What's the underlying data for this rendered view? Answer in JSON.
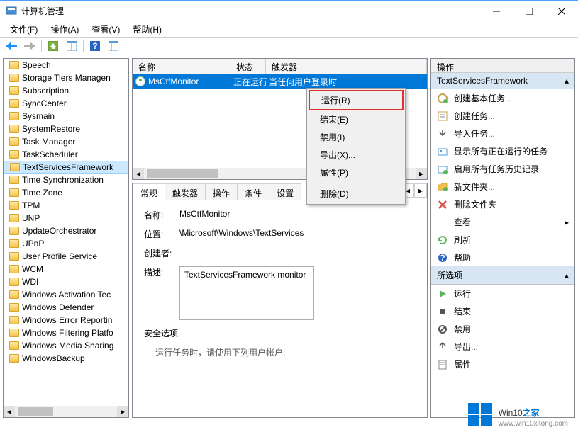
{
  "window": {
    "title": "计算机管理",
    "minimize": "—",
    "maximize": "☐",
    "close": "✕"
  },
  "menubar": [
    "文件(F)",
    "操作(A)",
    "查看(V)",
    "帮助(H)"
  ],
  "tree": {
    "items": [
      "Speech",
      "Storage Tiers Managen",
      "Subscription",
      "SyncCenter",
      "Sysmain",
      "SystemRestore",
      "Task Manager",
      "TaskScheduler",
      "TextServicesFramework",
      "Time Synchronization",
      "Time Zone",
      "TPM",
      "UNP",
      "UpdateOrchestrator",
      "UPnP",
      "User Profile Service",
      "WCM",
      "WDI",
      "Windows Activation Tec",
      "Windows Defender",
      "Windows Error Reportin",
      "Windows Filtering Platfo",
      "Windows Media Sharing",
      "WindowsBackup"
    ],
    "selectedIndex": 8
  },
  "taskList": {
    "columns": {
      "name": "名称",
      "state": "状态",
      "trigger": "触发器"
    },
    "row": {
      "name": "MsCtfMonitor",
      "state": "正在运行",
      "trigger": "当任何用户登录时"
    }
  },
  "contextMenu": {
    "items": [
      "运行(R)",
      "结束(E)",
      "禁用(I)",
      "导出(X)...",
      "属性(P)",
      "删除(D)"
    ],
    "highlightIndex": 0
  },
  "detail": {
    "tabs": [
      "常规",
      "触发器",
      "操作",
      "条件",
      "设置"
    ],
    "activeTab": 0,
    "fields": {
      "nameLabel": "名称:",
      "name": "MsCtfMonitor",
      "locLabel": "位置:",
      "loc": "\\Microsoft\\Windows\\TextServices",
      "authorLabel": "创建者:",
      "author": "",
      "descLabel": "描述:",
      "desc": "TextServicesFramework monitor",
      "secLabel": "安全选项",
      "secSub": "运行任务时，请使用下列用户帐户:"
    }
  },
  "actions": {
    "header": "操作",
    "section1": "TextServicesFramework",
    "group1": [
      {
        "icon": "create-basic",
        "label": "创建基本任务..."
      },
      {
        "icon": "create",
        "label": "创建任务..."
      },
      {
        "icon": "import",
        "label": "导入任务..."
      },
      {
        "icon": "show-running",
        "label": "显示所有正在运行的任务"
      },
      {
        "icon": "history",
        "label": "启用所有任务历史记录"
      },
      {
        "icon": "new-folder",
        "label": "新文件夹..."
      },
      {
        "icon": "delete",
        "label": "删除文件夹"
      },
      {
        "icon": "view",
        "label": "查看",
        "arrow": true
      },
      {
        "icon": "refresh",
        "label": "刷新"
      },
      {
        "icon": "help",
        "label": "帮助"
      }
    ],
    "section2": "所选项",
    "group2": [
      {
        "icon": "run",
        "label": "运行"
      },
      {
        "icon": "end",
        "label": "结束"
      },
      {
        "icon": "disable",
        "label": "禁用"
      },
      {
        "icon": "export",
        "label": "导出..."
      },
      {
        "icon": "props",
        "label": "属性"
      }
    ]
  },
  "watermark": {
    "brand1": "Win10",
    "brand2": "之家",
    "url": "www.win10xitong.com"
  }
}
